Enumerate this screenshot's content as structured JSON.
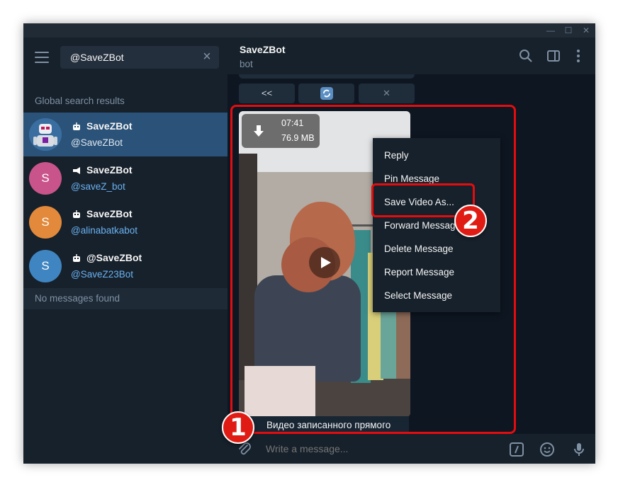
{
  "window": {
    "controls": [
      "—",
      "☐",
      "✕"
    ]
  },
  "search": {
    "value": "@SaveZBot"
  },
  "sidebar": {
    "section_label": "Global search results",
    "results": [
      {
        "title": "SaveZBot",
        "subtitle": "@SaveZBot",
        "type": "bot",
        "avatar_letter": "",
        "avatar_color": "#2e6ea6"
      },
      {
        "title": "SaveZBot",
        "subtitle": "@saveZ_bot",
        "type": "channel",
        "avatar_letter": "S",
        "avatar_color": "#c9548b"
      },
      {
        "title": "SaveZBot",
        "subtitle": "@alinabatkabot",
        "type": "bot",
        "avatar_letter": "S",
        "avatar_color": "#e2893b"
      },
      {
        "title": "@SaveZBot",
        "subtitle": "@SaveZ23Bot",
        "type": "bot",
        "avatar_letter": "S",
        "avatar_color": "#3f85c1"
      }
    ],
    "no_messages": "No messages found"
  },
  "chat": {
    "title": "SaveZBot",
    "status": "bot",
    "keyboard": [
      "<<",
      "",
      "✕"
    ],
    "video": {
      "duration": "07:41",
      "size": "76.9 MB"
    },
    "caption": "Видео записанного прямого",
    "compose_placeholder": "Write a message..."
  },
  "context_menu": {
    "items": [
      "Reply",
      "Pin Message",
      "Save Video As...",
      "Forward Message",
      "Delete Message",
      "Report Message",
      "Select Message"
    ]
  },
  "annotations": {
    "step1": "1",
    "step2": "2",
    "color": "#e30d10"
  }
}
